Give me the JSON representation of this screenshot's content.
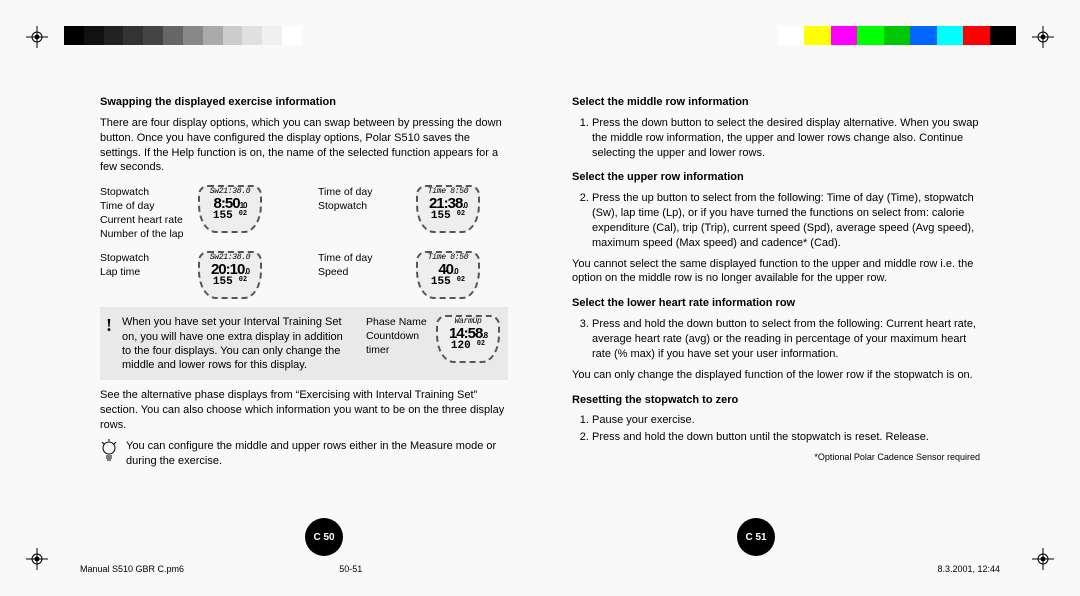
{
  "colorbars": {
    "left": [
      "#000",
      "#111",
      "#222",
      "#333",
      "#444",
      "#666",
      "#888",
      "#aaa",
      "#ccc",
      "#e0e0e0",
      "#f0f0f0",
      "#fff"
    ],
    "right": [
      "#fff",
      "#ffff00",
      "#ff00ff",
      "#00ff00",
      "#00c800",
      "#0066ff",
      "#00ffff",
      "#ff0000",
      "#000"
    ]
  },
  "left": {
    "title": "Swapping the displayed exercise information",
    "para1": "There are four display options, which you can swap between by pressing the down button. Once you have configured the display options, Polar S510 saves the settings. If the Help function is on, the name of the selected function appears for a few seconds.",
    "disp1": {
      "a": [
        "Stopwatch",
        "Time of day",
        "Current heart rate",
        "Number of the lap"
      ],
      "w": {
        "r1": "Sw21:38.0",
        "r2": "8:50",
        "r2s": "10",
        "r3a": "155",
        "r3b": "02"
      },
      "b": [
        "Time of day",
        "Stopwatch"
      ],
      "wb": {
        "r1": "Time 8:50",
        "r2": "21:38",
        "r2s": ".0",
        "r3a": "155",
        "r3b": "02"
      }
    },
    "disp2": {
      "a": [
        "Stopwatch",
        "Lap time"
      ],
      "w": {
        "r1": "Sw21:38.0",
        "r2": "20:10",
        "r2s": ".0",
        "r3a": "155",
        "r3b": "02"
      },
      "b": [
        "Time of day",
        "Speed"
      ],
      "wb": {
        "r1": "Time 8:50",
        "r2": "40",
        "r2s": ".0",
        "r3a": "155",
        "r3b": "02"
      }
    },
    "note": {
      "text": "When you have set your Interval Training Set on, you will have one extra display in addition to the four displays. You can only change the middle and lower rows for this display.",
      "labels": [
        "Phase Name",
        "Countdown",
        "timer"
      ],
      "w": {
        "r1": "WarmUp",
        "r2": "14:58",
        "r2s": ".8",
        "r3a": "120",
        "r3b": "02"
      }
    },
    "para2": "See the alternative phase displays from “Exercising with Interval Training Set” section. You can also choose which information you want to be on the three display rows.",
    "tip": "You can configure the middle and upper rows either in the Measure mode or during the exercise."
  },
  "right": {
    "sec1_title": "Select the middle row information",
    "sec1_item": "Press the down button to select the desired display alternative. When you swap the middle row information, the upper and lower rows change also. Continue selecting the upper and lower rows.",
    "sec2_title": "Select the upper row information",
    "sec2_item": "Press the up button to select from the following: Time of day (Time), stopwatch (Sw), lap time (Lp), or if you have turned the functions on select from: calorie expenditure (Cal), trip (Trip), current speed (Spd), average speed (Avg speed), maximum speed (Max speed) and cadence* (Cad).",
    "sec2_after": "You cannot select the same displayed function to the upper and middle row i.e. the option on the middle row is no longer available for the upper row.",
    "sec3_title": "Select the lower heart rate information row",
    "sec3_item": "Press and hold the down button to select from the following: Current heart rate, average heart rate (avg) or the reading in percentage of your maximum heart rate (% max) if you have set your user information.",
    "sec3_after": "You can only change the displayed function of the lower row if the stopwatch is on.",
    "sec4_title": "Resetting the stopwatch to zero",
    "sec4_items": [
      "Pause your exercise.",
      "Press and hold the down button until the stopwatch is reset. Release."
    ],
    "footnote": "*Optional Polar Cadence Sensor required"
  },
  "pagenums": {
    "left": "C 50",
    "right": "C 51"
  },
  "footer": {
    "file": "Manual S510 GBR C.pm6",
    "pages": "50-51",
    "date": "8.3.2001, 12:44"
  }
}
